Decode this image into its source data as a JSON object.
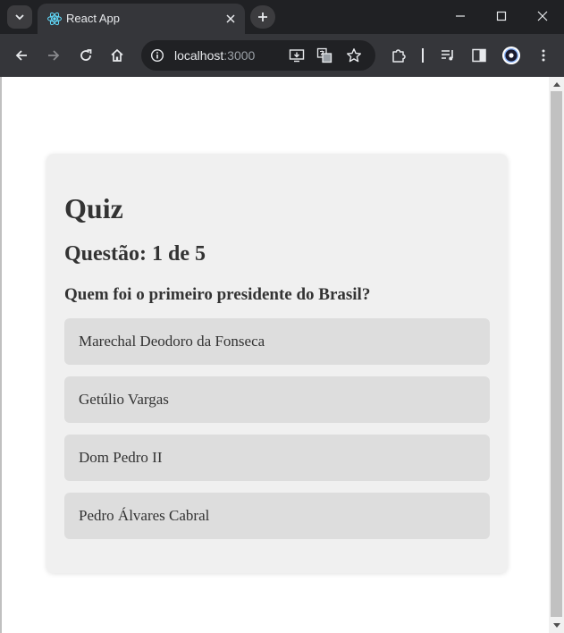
{
  "browser": {
    "tab": {
      "title": "React App",
      "favicon": "react-logo-icon"
    },
    "address": {
      "host": "localhost",
      "port": ":3000"
    },
    "colors": {
      "frame": "#202124",
      "toolbar": "#35363a",
      "react": "#61dafb",
      "profile": "#8ab4f8"
    }
  },
  "quiz": {
    "title": "Quiz",
    "question_counter": "Questão: 1 de 5",
    "question": "Quem foi o primeiro presidente do Brasil?",
    "answers": [
      "Marechal Deodoro da Fonseca",
      "Getúlio Vargas",
      "Dom Pedro II",
      "Pedro Álvares Cabral"
    ],
    "colors": {
      "card": "#f0f0f0",
      "answer": "#dddddd",
      "text": "#333333"
    }
  }
}
